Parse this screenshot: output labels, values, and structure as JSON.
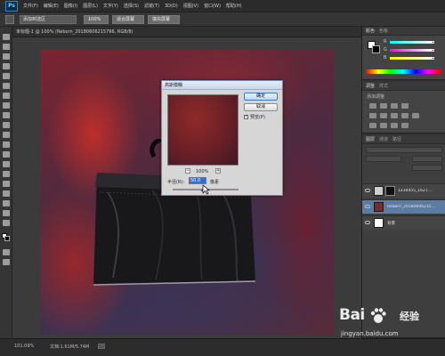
{
  "app": {
    "logo": "Ps"
  },
  "menu": {
    "items": [
      "文件(F)",
      "编辑(E)",
      "图像(I)",
      "图层(L)",
      "文字(Y)",
      "选择(S)",
      "滤镜(T)",
      "3D(D)",
      "视图(V)",
      "窗口(W)",
      "帮助(H)"
    ]
  },
  "options": {
    "mode_label": "添加到选区",
    "zoom_value": "100%",
    "fit_button": "适合屏幕",
    "fill_button": "填充屏幕"
  },
  "document": {
    "tab_label": "未标题-1 @ 100% (Reborn_20180606215766, RGB/8)"
  },
  "status": {
    "zoom": "101.09%",
    "doc_size": "文档:1.61M/5.74M"
  },
  "panels": {
    "color": {
      "tabs": [
        "颜色",
        "色板"
      ],
      "sliders": [
        "R",
        "G",
        "B"
      ],
      "fg_color": "#ffffff",
      "bg_color": "#000000"
    },
    "adjustments": {
      "tabs": [
        "调整",
        "样式"
      ],
      "subtitle": "添加调整"
    },
    "layers": {
      "tabs": [
        "图层",
        "通道",
        "路径"
      ],
      "rows": [
        {
          "name": "1234455_1627...",
          "selected": false,
          "thumb": "#cfcfcf"
        },
        {
          "name": "Reborn_20180606215...",
          "selected": true,
          "thumb": "#7a2a2a"
        },
        {
          "name": "背景",
          "selected": false,
          "thumb": "#ffffff"
        }
      ]
    }
  },
  "dialog": {
    "title": "高斯模糊",
    "ok": "确定",
    "cancel": "取消",
    "preview_label": "预览(P)",
    "preview_checked": "✓",
    "zoom_value": "100%",
    "radius_label": "半径(R):",
    "radius_value": "50.0",
    "radius_unit": "像素",
    "zoom_in": "+",
    "zoom_out": "−"
  },
  "watermark": {
    "brand": "Bai",
    "brand_suffix": "经验",
    "url": "jingyan.baidu.com"
  }
}
